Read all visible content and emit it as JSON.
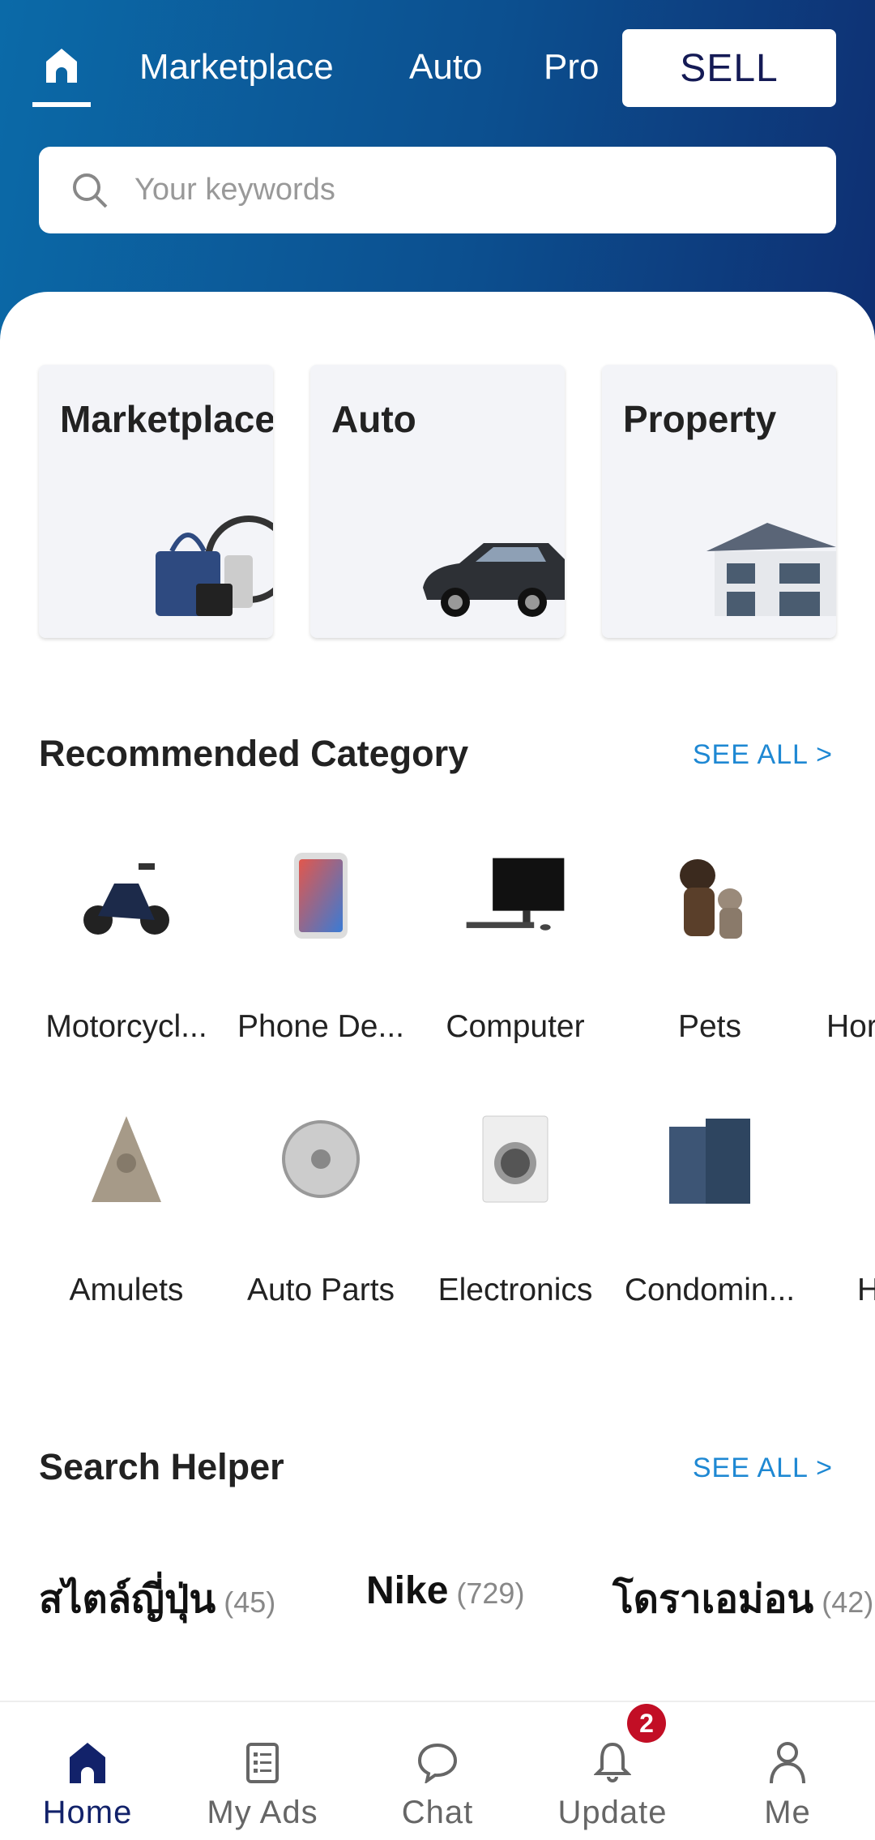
{
  "topnav": {
    "links": [
      "Marketplace",
      "Auto",
      "Pro"
    ],
    "sell_label": "SELL"
  },
  "search": {
    "placeholder": "Your keywords"
  },
  "cards": [
    {
      "label": "Marketplace"
    },
    {
      "label": "Auto"
    },
    {
      "label": "Property"
    }
  ],
  "recommended": {
    "title": "Recommended Category",
    "see_all": "SEE ALL >",
    "row1": [
      "Motorcycl...",
      "Phone De...",
      "Computer",
      "Pets",
      "Hor"
    ],
    "row2": [
      "Amulets",
      "Auto Parts",
      "Electronics",
      "Condomin...",
      "H"
    ]
  },
  "helper": {
    "title": "Search Helper",
    "see_all": "SEE ALL >",
    "chips": [
      {
        "label": "สไตล์ญี่ปุ่น",
        "count": "(45)"
      },
      {
        "label": "Nike",
        "count": "(729)"
      },
      {
        "label": "โดราเอม่อน",
        "count": "(42)"
      }
    ]
  },
  "bottom_nav": [
    {
      "label": "Home"
    },
    {
      "label": "My Ads"
    },
    {
      "label": "Chat"
    },
    {
      "label": "Update",
      "badge": "2"
    },
    {
      "label": "Me"
    }
  ],
  "colors": {
    "brand": "#0c4f8f",
    "accent": "#1e88d3",
    "active": "#12226a",
    "badge": "#c20e25"
  }
}
